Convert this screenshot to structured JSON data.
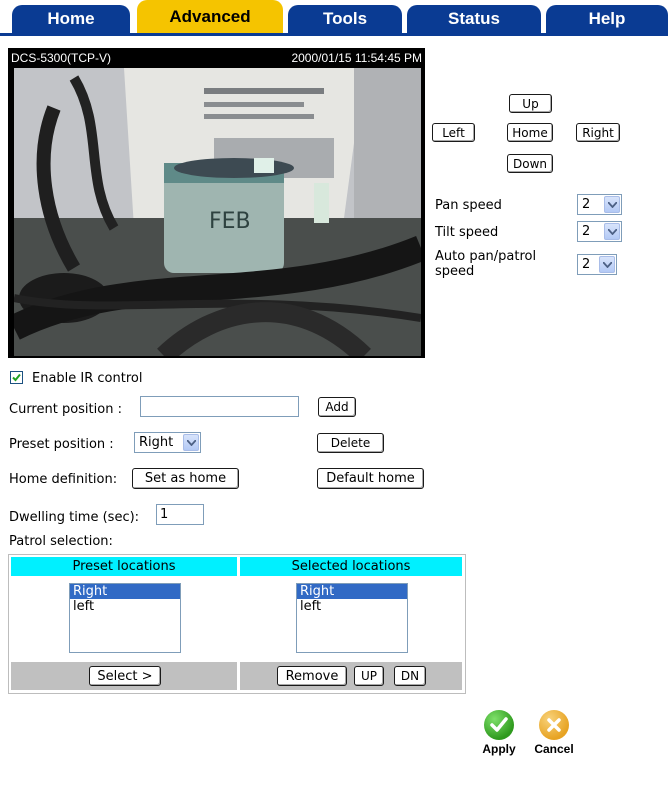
{
  "tabs": [
    {
      "label": "Home",
      "active": false
    },
    {
      "label": "Advanced",
      "active": true
    },
    {
      "label": "Tools",
      "active": false
    },
    {
      "label": "Status",
      "active": false
    },
    {
      "label": "Help",
      "active": false
    }
  ],
  "camera": {
    "model": "DCS-5300(TCP-V)",
    "timestamp": "2000/01/15 11:54:45 PM"
  },
  "ptz": {
    "up": "Up",
    "left": "Left",
    "home": "Home",
    "right": "Right",
    "down": "Down"
  },
  "speeds": {
    "pan_label": "Pan speed",
    "pan_value": "2",
    "tilt_label": "Tilt speed",
    "tilt_value": "2",
    "auto_label_line1": "Auto pan/patrol",
    "auto_label_line2": "speed",
    "auto_value": "2"
  },
  "settings": {
    "enable_ir_label": "Enable IR control",
    "enable_ir_checked": true,
    "current_position_label": "Current position :",
    "current_position_value": "",
    "add_button": "Add",
    "preset_position_label": "Preset position :",
    "preset_position_value": "Right",
    "delete_button": "Delete",
    "home_definition_label": "Home definition:",
    "set_as_home_button": "Set as home",
    "default_home_button": "Default home",
    "dwelling_label": "Dwelling time (sec):",
    "dwelling_value": "1",
    "patrol_label": "Patrol selection:"
  },
  "patrol": {
    "preset_header": "Preset locations",
    "selected_header": "Selected locations",
    "preset_items": [
      {
        "label": "Right",
        "selected": true
      },
      {
        "label": "left",
        "selected": false
      }
    ],
    "selected_items": [
      {
        "label": "Right",
        "selected": true
      },
      {
        "label": "left",
        "selected": false
      }
    ],
    "select_button": "Select >",
    "remove_button": "Remove",
    "up_button": "UP",
    "dn_button": "DN"
  },
  "actions": {
    "apply_label": "Apply",
    "cancel_label": "Cancel"
  },
  "colors": {
    "tab_blue": "#0a3b93",
    "tab_active": "#f5c400",
    "header_cyan": "#00f0ff",
    "selection_blue": "#316ac5",
    "apply_green": "#2f9a1e",
    "cancel_orange": "#e7a323"
  }
}
